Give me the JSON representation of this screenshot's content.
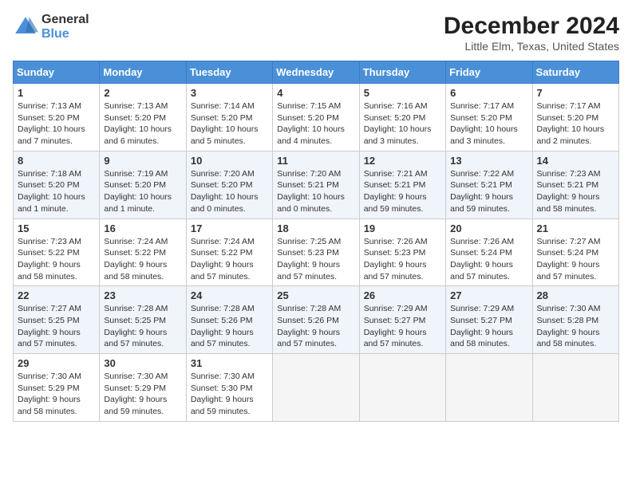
{
  "logo": {
    "general": "General",
    "blue": "Blue"
  },
  "title": {
    "month_year": "December 2024",
    "location": "Little Elm, Texas, United States"
  },
  "columns": [
    "Sunday",
    "Monday",
    "Tuesday",
    "Wednesday",
    "Thursday",
    "Friday",
    "Saturday"
  ],
  "weeks": [
    [
      {
        "day": "1",
        "sunrise": "7:13 AM",
        "sunset": "5:20 PM",
        "daylight": "10 hours and 7 minutes."
      },
      {
        "day": "2",
        "sunrise": "7:13 AM",
        "sunset": "5:20 PM",
        "daylight": "10 hours and 6 minutes."
      },
      {
        "day": "3",
        "sunrise": "7:14 AM",
        "sunset": "5:20 PM",
        "daylight": "10 hours and 5 minutes."
      },
      {
        "day": "4",
        "sunrise": "7:15 AM",
        "sunset": "5:20 PM",
        "daylight": "10 hours and 4 minutes."
      },
      {
        "day": "5",
        "sunrise": "7:16 AM",
        "sunset": "5:20 PM",
        "daylight": "10 hours and 3 minutes."
      },
      {
        "day": "6",
        "sunrise": "7:17 AM",
        "sunset": "5:20 PM",
        "daylight": "10 hours and 3 minutes."
      },
      {
        "day": "7",
        "sunrise": "7:17 AM",
        "sunset": "5:20 PM",
        "daylight": "10 hours and 2 minutes."
      }
    ],
    [
      {
        "day": "8",
        "sunrise": "7:18 AM",
        "sunset": "5:20 PM",
        "daylight": "10 hours and 1 minute."
      },
      {
        "day": "9",
        "sunrise": "7:19 AM",
        "sunset": "5:20 PM",
        "daylight": "10 hours and 1 minute."
      },
      {
        "day": "10",
        "sunrise": "7:20 AM",
        "sunset": "5:20 PM",
        "daylight": "10 hours and 0 minutes."
      },
      {
        "day": "11",
        "sunrise": "7:20 AM",
        "sunset": "5:21 PM",
        "daylight": "10 hours and 0 minutes."
      },
      {
        "day": "12",
        "sunrise": "7:21 AM",
        "sunset": "5:21 PM",
        "daylight": "9 hours and 59 minutes."
      },
      {
        "day": "13",
        "sunrise": "7:22 AM",
        "sunset": "5:21 PM",
        "daylight": "9 hours and 59 minutes."
      },
      {
        "day": "14",
        "sunrise": "7:23 AM",
        "sunset": "5:21 PM",
        "daylight": "9 hours and 58 minutes."
      }
    ],
    [
      {
        "day": "15",
        "sunrise": "7:23 AM",
        "sunset": "5:22 PM",
        "daylight": "9 hours and 58 minutes."
      },
      {
        "day": "16",
        "sunrise": "7:24 AM",
        "sunset": "5:22 PM",
        "daylight": "9 hours and 58 minutes."
      },
      {
        "day": "17",
        "sunrise": "7:24 AM",
        "sunset": "5:22 PM",
        "daylight": "9 hours and 57 minutes."
      },
      {
        "day": "18",
        "sunrise": "7:25 AM",
        "sunset": "5:23 PM",
        "daylight": "9 hours and 57 minutes."
      },
      {
        "day": "19",
        "sunrise": "7:26 AM",
        "sunset": "5:23 PM",
        "daylight": "9 hours and 57 minutes."
      },
      {
        "day": "20",
        "sunrise": "7:26 AM",
        "sunset": "5:24 PM",
        "daylight": "9 hours and 57 minutes."
      },
      {
        "day": "21",
        "sunrise": "7:27 AM",
        "sunset": "5:24 PM",
        "daylight": "9 hours and 57 minutes."
      }
    ],
    [
      {
        "day": "22",
        "sunrise": "7:27 AM",
        "sunset": "5:25 PM",
        "daylight": "9 hours and 57 minutes."
      },
      {
        "day": "23",
        "sunrise": "7:28 AM",
        "sunset": "5:25 PM",
        "daylight": "9 hours and 57 minutes."
      },
      {
        "day": "24",
        "sunrise": "7:28 AM",
        "sunset": "5:26 PM",
        "daylight": "9 hours and 57 minutes."
      },
      {
        "day": "25",
        "sunrise": "7:28 AM",
        "sunset": "5:26 PM",
        "daylight": "9 hours and 57 minutes."
      },
      {
        "day": "26",
        "sunrise": "7:29 AM",
        "sunset": "5:27 PM",
        "daylight": "9 hours and 57 minutes."
      },
      {
        "day": "27",
        "sunrise": "7:29 AM",
        "sunset": "5:27 PM",
        "daylight": "9 hours and 58 minutes."
      },
      {
        "day": "28",
        "sunrise": "7:30 AM",
        "sunset": "5:28 PM",
        "daylight": "9 hours and 58 minutes."
      }
    ],
    [
      {
        "day": "29",
        "sunrise": "7:30 AM",
        "sunset": "5:29 PM",
        "daylight": "9 hours and 58 minutes."
      },
      {
        "day": "30",
        "sunrise": "7:30 AM",
        "sunset": "5:29 PM",
        "daylight": "9 hours and 59 minutes."
      },
      {
        "day": "31",
        "sunrise": "7:30 AM",
        "sunset": "5:30 PM",
        "daylight": "9 hours and 59 minutes."
      },
      null,
      null,
      null,
      null
    ]
  ]
}
